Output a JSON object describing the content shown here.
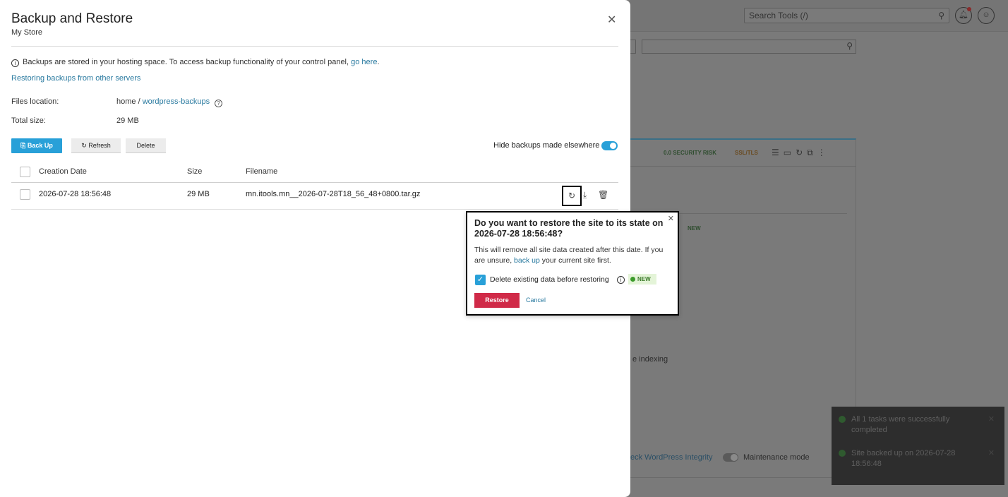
{
  "background": {
    "search_placeholder": "Search Tools (/)",
    "security_badge": "0.0 SECURITY RISK",
    "ssl_badge": "SSL/TLS",
    "new_badge": "NEW",
    "indexing_label": "e indexing",
    "integrity_link": "eck WordPress Integrity",
    "maintenance_label": "Maintenance mode"
  },
  "toasts": [
    {
      "text": "All 1 tasks were successfully completed"
    },
    {
      "text": "Site backed up on 2026-07-28 18:56:48"
    }
  ],
  "modal": {
    "title": "Backup and Restore",
    "subtitle": "My Store",
    "info_text": "Backups are stored in your hosting space. To access backup functionality of your control panel,",
    "info_link": "go here",
    "info_period": ".",
    "restore_other_link": "Restoring backups from other servers",
    "files_location_label": "Files location:",
    "files_location_prefix": "home /",
    "files_location_link": "wordpress-backups",
    "total_size_label": "Total size:",
    "total_size_value": "29 MB",
    "buttons": {
      "backup": "Back Up",
      "refresh": "Refresh",
      "delete": "Delete"
    },
    "hide_label": "Hide backups made elsewhere",
    "hide_toggle_on": true,
    "table": {
      "columns": [
        "Creation Date",
        "Size",
        "Filename"
      ],
      "rows": [
        {
          "date": "2026-07-28 18:56:48",
          "size": "29 MB",
          "filename": "mn.itools.mn__2026-07-28T18_56_48+0800.tar.gz"
        }
      ]
    }
  },
  "popover": {
    "title": "Do you want to restore the site to its state on 2026-07-28 18:56:48?",
    "body_pre": "This will remove all site data created after this date. If you are unsure,",
    "body_link": "back up",
    "body_post": "your current site first.",
    "checkbox_label": "Delete existing data before restoring",
    "checkbox_checked": true,
    "new_badge": "NEW",
    "restore_button": "Restore",
    "cancel_button": "Cancel"
  }
}
